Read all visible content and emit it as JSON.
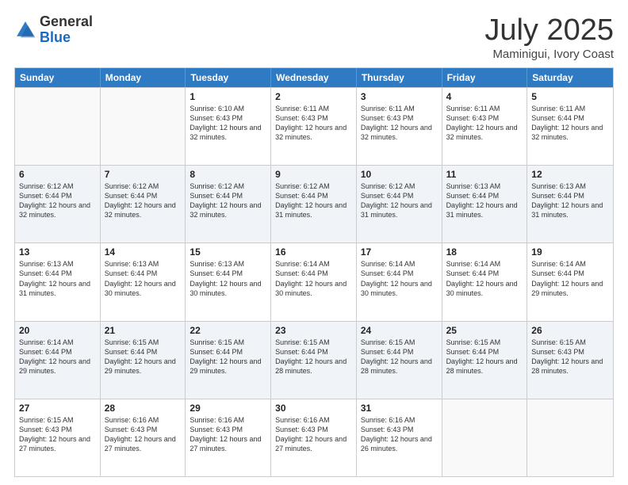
{
  "header": {
    "logo_general": "General",
    "logo_blue": "Blue",
    "month": "July 2025",
    "location": "Maminigui, Ivory Coast"
  },
  "days_of_week": [
    "Sunday",
    "Monday",
    "Tuesday",
    "Wednesday",
    "Thursday",
    "Friday",
    "Saturday"
  ],
  "rows": [
    {
      "cells": [
        {
          "day": "",
          "empty": true
        },
        {
          "day": "",
          "empty": true
        },
        {
          "day": "1",
          "sunrise": "Sunrise: 6:10 AM",
          "sunset": "Sunset: 6:43 PM",
          "daylight": "Daylight: 12 hours and 32 minutes."
        },
        {
          "day": "2",
          "sunrise": "Sunrise: 6:11 AM",
          "sunset": "Sunset: 6:43 PM",
          "daylight": "Daylight: 12 hours and 32 minutes."
        },
        {
          "day": "3",
          "sunrise": "Sunrise: 6:11 AM",
          "sunset": "Sunset: 6:43 PM",
          "daylight": "Daylight: 12 hours and 32 minutes."
        },
        {
          "day": "4",
          "sunrise": "Sunrise: 6:11 AM",
          "sunset": "Sunset: 6:43 PM",
          "daylight": "Daylight: 12 hours and 32 minutes."
        },
        {
          "day": "5",
          "sunrise": "Sunrise: 6:11 AM",
          "sunset": "Sunset: 6:44 PM",
          "daylight": "Daylight: 12 hours and 32 minutes."
        }
      ]
    },
    {
      "cells": [
        {
          "day": "6",
          "sunrise": "Sunrise: 6:12 AM",
          "sunset": "Sunset: 6:44 PM",
          "daylight": "Daylight: 12 hours and 32 minutes."
        },
        {
          "day": "7",
          "sunrise": "Sunrise: 6:12 AM",
          "sunset": "Sunset: 6:44 PM",
          "daylight": "Daylight: 12 hours and 32 minutes."
        },
        {
          "day": "8",
          "sunrise": "Sunrise: 6:12 AM",
          "sunset": "Sunset: 6:44 PM",
          "daylight": "Daylight: 12 hours and 32 minutes."
        },
        {
          "day": "9",
          "sunrise": "Sunrise: 6:12 AM",
          "sunset": "Sunset: 6:44 PM",
          "daylight": "Daylight: 12 hours and 31 minutes."
        },
        {
          "day": "10",
          "sunrise": "Sunrise: 6:12 AM",
          "sunset": "Sunset: 6:44 PM",
          "daylight": "Daylight: 12 hours and 31 minutes."
        },
        {
          "day": "11",
          "sunrise": "Sunrise: 6:13 AM",
          "sunset": "Sunset: 6:44 PM",
          "daylight": "Daylight: 12 hours and 31 minutes."
        },
        {
          "day": "12",
          "sunrise": "Sunrise: 6:13 AM",
          "sunset": "Sunset: 6:44 PM",
          "daylight": "Daylight: 12 hours and 31 minutes."
        }
      ]
    },
    {
      "cells": [
        {
          "day": "13",
          "sunrise": "Sunrise: 6:13 AM",
          "sunset": "Sunset: 6:44 PM",
          "daylight": "Daylight: 12 hours and 31 minutes."
        },
        {
          "day": "14",
          "sunrise": "Sunrise: 6:13 AM",
          "sunset": "Sunset: 6:44 PM",
          "daylight": "Daylight: 12 hours and 30 minutes."
        },
        {
          "day": "15",
          "sunrise": "Sunrise: 6:13 AM",
          "sunset": "Sunset: 6:44 PM",
          "daylight": "Daylight: 12 hours and 30 minutes."
        },
        {
          "day": "16",
          "sunrise": "Sunrise: 6:14 AM",
          "sunset": "Sunset: 6:44 PM",
          "daylight": "Daylight: 12 hours and 30 minutes."
        },
        {
          "day": "17",
          "sunrise": "Sunrise: 6:14 AM",
          "sunset": "Sunset: 6:44 PM",
          "daylight": "Daylight: 12 hours and 30 minutes."
        },
        {
          "day": "18",
          "sunrise": "Sunrise: 6:14 AM",
          "sunset": "Sunset: 6:44 PM",
          "daylight": "Daylight: 12 hours and 30 minutes."
        },
        {
          "day": "19",
          "sunrise": "Sunrise: 6:14 AM",
          "sunset": "Sunset: 6:44 PM",
          "daylight": "Daylight: 12 hours and 29 minutes."
        }
      ]
    },
    {
      "cells": [
        {
          "day": "20",
          "sunrise": "Sunrise: 6:14 AM",
          "sunset": "Sunset: 6:44 PM",
          "daylight": "Daylight: 12 hours and 29 minutes."
        },
        {
          "day": "21",
          "sunrise": "Sunrise: 6:15 AM",
          "sunset": "Sunset: 6:44 PM",
          "daylight": "Daylight: 12 hours and 29 minutes."
        },
        {
          "day": "22",
          "sunrise": "Sunrise: 6:15 AM",
          "sunset": "Sunset: 6:44 PM",
          "daylight": "Daylight: 12 hours and 29 minutes."
        },
        {
          "day": "23",
          "sunrise": "Sunrise: 6:15 AM",
          "sunset": "Sunset: 6:44 PM",
          "daylight": "Daylight: 12 hours and 28 minutes."
        },
        {
          "day": "24",
          "sunrise": "Sunrise: 6:15 AM",
          "sunset": "Sunset: 6:44 PM",
          "daylight": "Daylight: 12 hours and 28 minutes."
        },
        {
          "day": "25",
          "sunrise": "Sunrise: 6:15 AM",
          "sunset": "Sunset: 6:44 PM",
          "daylight": "Daylight: 12 hours and 28 minutes."
        },
        {
          "day": "26",
          "sunrise": "Sunrise: 6:15 AM",
          "sunset": "Sunset: 6:43 PM",
          "daylight": "Daylight: 12 hours and 28 minutes."
        }
      ]
    },
    {
      "cells": [
        {
          "day": "27",
          "sunrise": "Sunrise: 6:15 AM",
          "sunset": "Sunset: 6:43 PM",
          "daylight": "Daylight: 12 hours and 27 minutes."
        },
        {
          "day": "28",
          "sunrise": "Sunrise: 6:16 AM",
          "sunset": "Sunset: 6:43 PM",
          "daylight": "Daylight: 12 hours and 27 minutes."
        },
        {
          "day": "29",
          "sunrise": "Sunrise: 6:16 AM",
          "sunset": "Sunset: 6:43 PM",
          "daylight": "Daylight: 12 hours and 27 minutes."
        },
        {
          "day": "30",
          "sunrise": "Sunrise: 6:16 AM",
          "sunset": "Sunset: 6:43 PM",
          "daylight": "Daylight: 12 hours and 27 minutes."
        },
        {
          "day": "31",
          "sunrise": "Sunrise: 6:16 AM",
          "sunset": "Sunset: 6:43 PM",
          "daylight": "Daylight: 12 hours and 26 minutes."
        },
        {
          "day": "",
          "empty": true
        },
        {
          "day": "",
          "empty": true
        }
      ]
    }
  ]
}
